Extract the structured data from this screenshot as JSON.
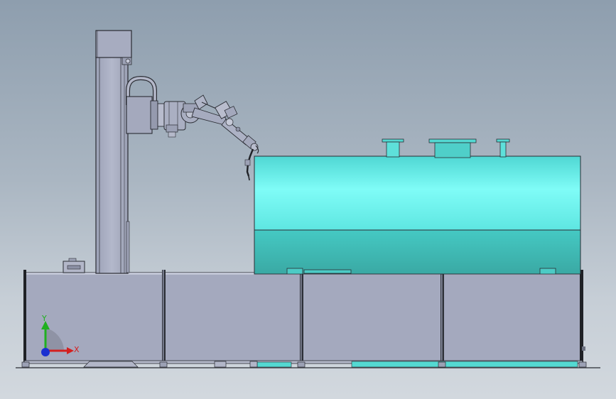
{
  "viewport": {
    "background_top": "#8e9eae",
    "background_bottom": "#d2d8de"
  },
  "model": {
    "parts": [
      "gantry-column",
      "column-top-motor",
      "robot-arm",
      "welding-torch",
      "cylindrical-tank",
      "tank-nozzle-left",
      "tank-manway",
      "tank-nozzle-right",
      "base-frame"
    ],
    "colors": {
      "steel": "#a4a9be",
      "steel_dark": "#23252b",
      "tank_top": "#6ff7f2",
      "tank_bottom": "#3fbfb8"
    }
  },
  "triad": {
    "x_label": "X",
    "y_label": "Y",
    "x_color": "#d42020",
    "y_color": "#20b020",
    "z_color": "#1a2fd0"
  }
}
